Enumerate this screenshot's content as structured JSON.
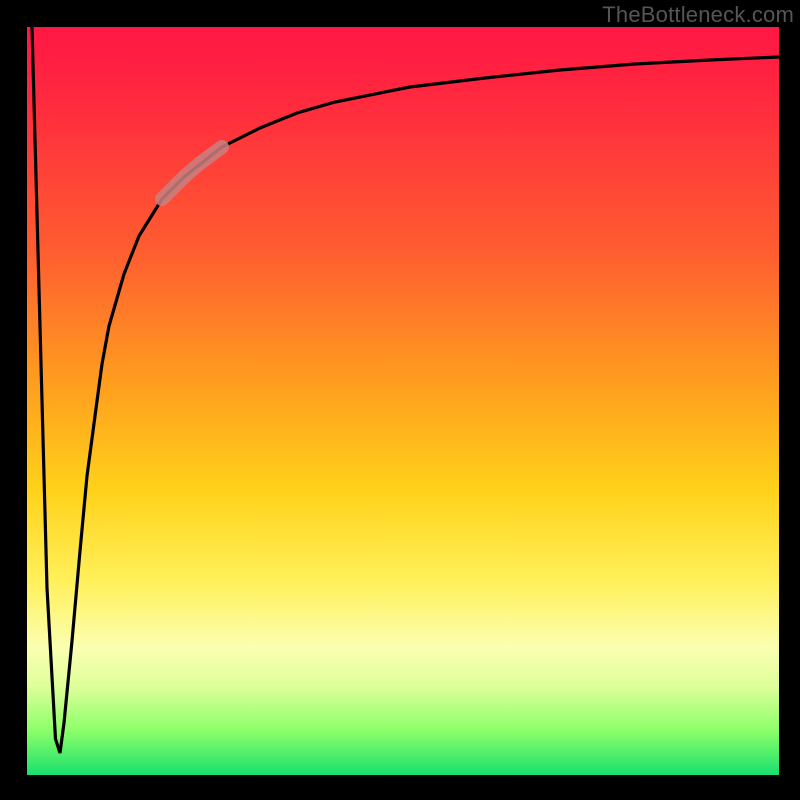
{
  "watermark": "TheBottleneck.com",
  "colors": {
    "frame": "#000000",
    "gradient_top": "#ff1744",
    "gradient_bottom": "#18e06c",
    "curve": "#000000",
    "highlight": "#c98080"
  },
  "chart_data": {
    "type": "line",
    "title": "",
    "xlabel": "",
    "ylabel": "",
    "xlim": [
      0,
      100
    ],
    "ylim": [
      0,
      100
    ],
    "grid": false,
    "legend": false,
    "series": [
      {
        "name": "bottleneck-curve",
        "x": [
          0,
          1,
          2,
          3,
          3.5,
          4,
          5,
          6,
          7,
          8,
          9,
          10,
          12,
          14,
          17,
          20,
          25,
          30,
          35,
          40,
          50,
          60,
          70,
          80,
          90,
          100
        ],
        "values": [
          100,
          60,
          25,
          5,
          3,
          7,
          18,
          30,
          40,
          48,
          55,
          60,
          67,
          72,
          77,
          80,
          84,
          86.5,
          88.5,
          90,
          92,
          93.2,
          94.2,
          95,
          95.6,
          96
        ]
      },
      {
        "name": "highlight-segment",
        "x": [
          17,
          18,
          19,
          20,
          21,
          22,
          23,
          25
        ],
        "values": [
          77,
          78,
          79,
          80,
          80.8,
          81.6,
          82.3,
          84
        ]
      }
    ],
    "annotations": []
  }
}
